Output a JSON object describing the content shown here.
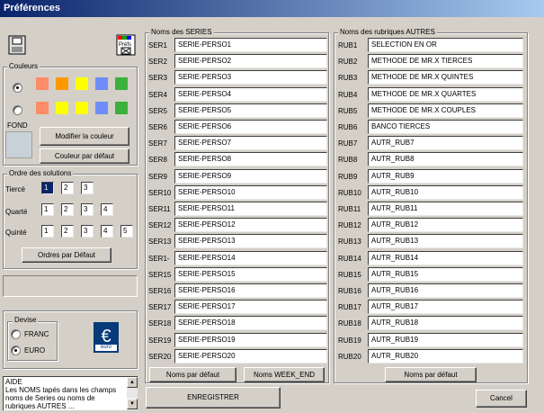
{
  "window": {
    "title": "Préférences"
  },
  "colors": {
    "legend": "Couleurs",
    "row1": [
      "#ff8c69",
      "#ff9900",
      "#ffff00",
      "#6f8dfa",
      "#3cb03c"
    ],
    "row2": [
      "#ff8c69",
      "#ffff00",
      "#ffff00",
      "#6f8dfa",
      "#3cb03c"
    ],
    "fond_label": "FOND",
    "modify_button": "Modifier la couleur",
    "default_button": "Couleur par défaut"
  },
  "order": {
    "legend": "Ordre des solutions",
    "tierce_label": "Tiercé",
    "tierce_values": [
      "1",
      "2",
      "3"
    ],
    "quarte_label": "Quarté",
    "quarte_values": [
      "1",
      "2",
      "3",
      "4"
    ],
    "quinte_label": "Quinté",
    "quinte_values": [
      "1",
      "2",
      "3",
      "4",
      "5"
    ],
    "default_button": "Ordres par Défaut"
  },
  "currency": {
    "legend": "Devise",
    "options": [
      "FRANC",
      "EURO"
    ],
    "selected": "EURO",
    "logo_text": "euro"
  },
  "help": {
    "text": "AIDE\nLes NOMS tapés dans les champs\nnoms de Series ou noms de\nrubriques AUTRES ..."
  },
  "series": {
    "legend": "Noms des SERIES",
    "labels": [
      "SER1",
      "SER2",
      "SER3",
      "SER4",
      "SER5",
      "SER6",
      "SER7",
      "SER8",
      "SER9",
      "SER10",
      "SER11",
      "SER12",
      "SER13",
      "SER1-",
      "SER15",
      "SER16",
      "SER17",
      "SER18",
      "SER19",
      "SER20"
    ],
    "values": [
      "SERIE-PERSO1",
      "SERIE-PERSO2",
      "SERIE-PERSO3",
      "SERIE-PERSO4",
      "SERIE-PERSO5",
      "SERIE-PERSO6",
      "SERIE-PERSO7",
      "SERIE-PERSO8",
      "SERIE-PERSO9",
      "SERIE-PERSO10",
      "SERIE-PERSO11",
      "SERIE-PERSO12",
      "SERIE-PERSO13",
      "SERIE-PERSO14",
      "SERIE-PERSO15",
      "SERIE-PERSO16",
      "SERIE-PERSO17",
      "SERIE-PERSO18",
      "SERIE-PERSO19",
      "SERIE-PERSO20"
    ],
    "default_button": "Noms par défaut",
    "weekend_button": "Noms WEEK_END"
  },
  "rubriques": {
    "legend": "Noms des rubriques AUTRES",
    "labels": [
      "RUB1",
      "RUB2",
      "RUB3",
      "RUB4",
      "RUB5",
      "RUB6",
      "RUB7",
      "RUB8",
      "RUB9",
      "RUB10",
      "RUB11",
      "RUB12",
      "RUB13",
      "RUB14",
      "RUB15",
      "RUB16",
      "RUB17",
      "RUB18",
      "RUB19",
      "RUB20"
    ],
    "values": [
      "SELECTION EN OR",
      "METHODE DE MR.X TIERCES",
      "METHODE DE MR.X QUINTES",
      "METHODE DE MR.X QUARTES",
      "METHODE DE MR.X COUPLES",
      "BANCO TIERCES",
      "AUTR_RUB7",
      "AUTR_RUB8",
      "AUTR_RUB9",
      "AUTR_RUB10",
      "AUTR_RUB11",
      "AUTR_RUB12",
      "AUTR_RUB13",
      "AUTR_RUB14",
      "AUTR_RUB15",
      "AUTR_RUB16",
      "AUTR_RUB17",
      "AUTR_RUB18",
      "AUTR_RUB19",
      "AUTR_RUB20"
    ],
    "default_button": "Noms par défaut"
  },
  "footer": {
    "save_button": "ENREGISTRER",
    "cancel_button": "Cancel"
  }
}
